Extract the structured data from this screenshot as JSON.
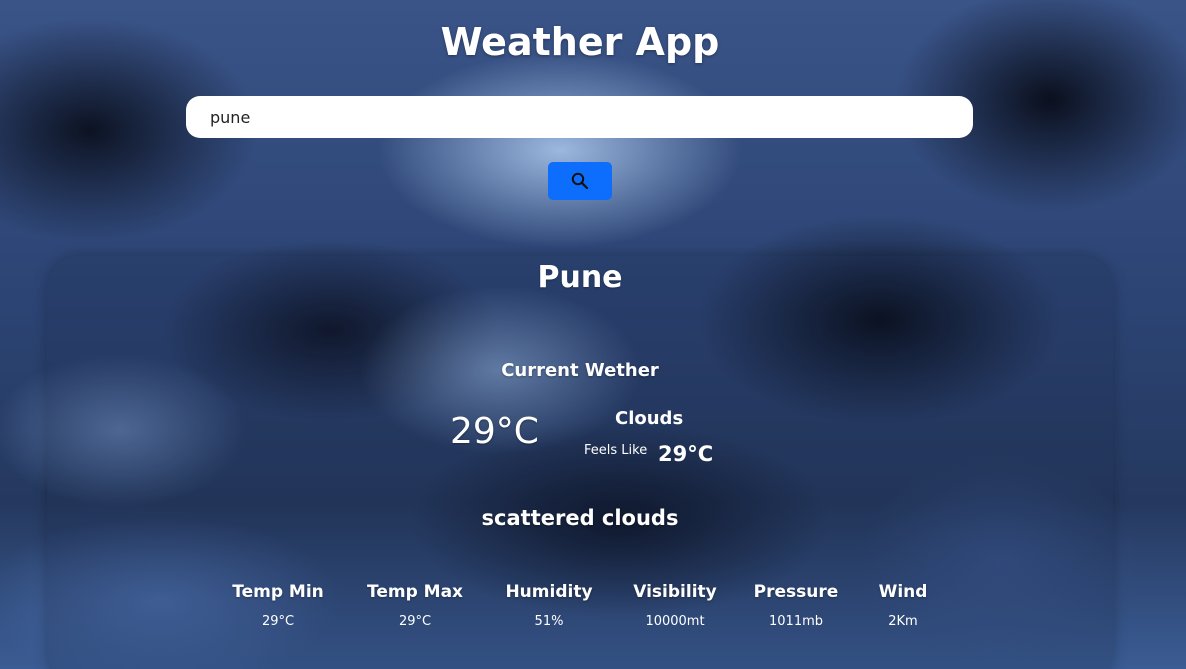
{
  "header": {
    "title": "Weather App"
  },
  "search": {
    "value": "pune",
    "button_icon": "search-icon",
    "button_color": "#0d6efd"
  },
  "weather": {
    "city": "Pune",
    "current_label": "Current Wether",
    "temperature": "29°C",
    "condition": "Clouds",
    "feels_like_label": "Feels Like",
    "feels_like_value": "29°C",
    "description": "scattered clouds"
  },
  "stats": [
    {
      "label": "Temp Min",
      "value": "29°C"
    },
    {
      "label": "Temp Max",
      "value": "29°C"
    },
    {
      "label": "Humidity",
      "value": "51%"
    },
    {
      "label": "Visibility",
      "value": "10000mt"
    },
    {
      "label": "Pressure",
      "value": "1011mb"
    },
    {
      "label": "Wind",
      "value": "2Km"
    }
  ]
}
